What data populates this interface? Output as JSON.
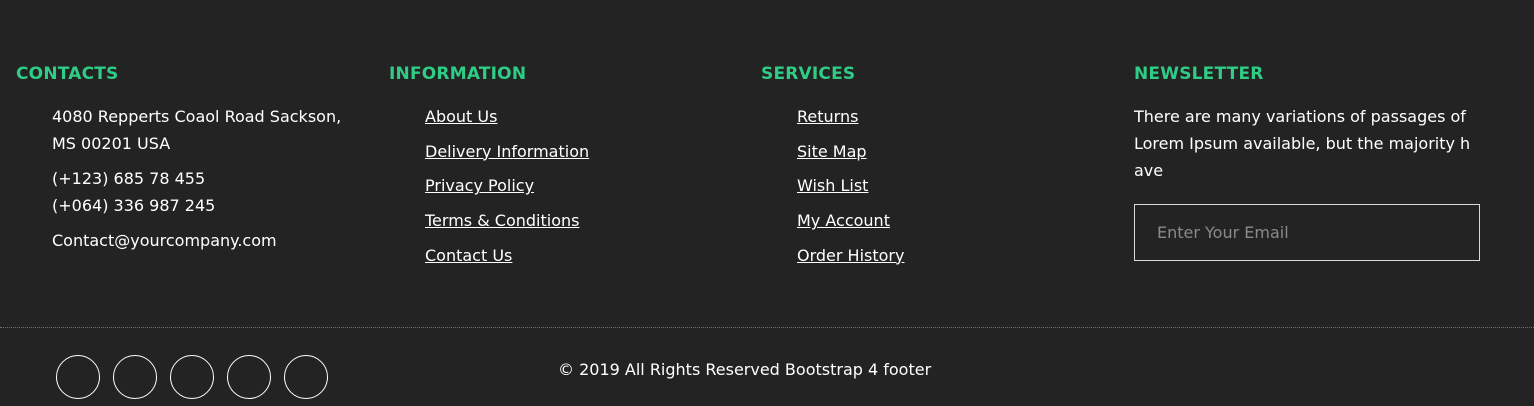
{
  "contacts": {
    "heading": "CONTACTS",
    "address_line1": "4080 Repperts Coaol Road Sackson,",
    "address_line2": "MS 00201 USA",
    "phone1": "(+123) 685 78 455",
    "phone2": "(+064) 336 987 245",
    "email": "Contact@yourcompany.com"
  },
  "information": {
    "heading": "INFORMATION",
    "links": [
      "About Us",
      "Delivery Information",
      "Privacy Policy",
      "Terms & Conditions",
      "Contact Us"
    ]
  },
  "services": {
    "heading": "SERVICES",
    "links": [
      "Returns",
      "Site Map",
      "Wish List",
      "My Account",
      "Order History"
    ]
  },
  "newsletter": {
    "heading": "NEWSLETTER",
    "text": "There are many variations of passages of Lorem Ipsum available, but the majority h ave",
    "email_placeholder": "Enter Your Email",
    "email_value": ""
  },
  "bottom": {
    "copyright": "© 2019 All Rights Reserved Bootstrap 4 footer",
    "social_icons": [
      "facebook-icon",
      "twitter-icon",
      "google-plus-icon",
      "linkedin-icon",
      "instagram-icon"
    ]
  },
  "colors": {
    "background": "#232323",
    "accent": "#2ecc85",
    "text": "#ffffff"
  }
}
